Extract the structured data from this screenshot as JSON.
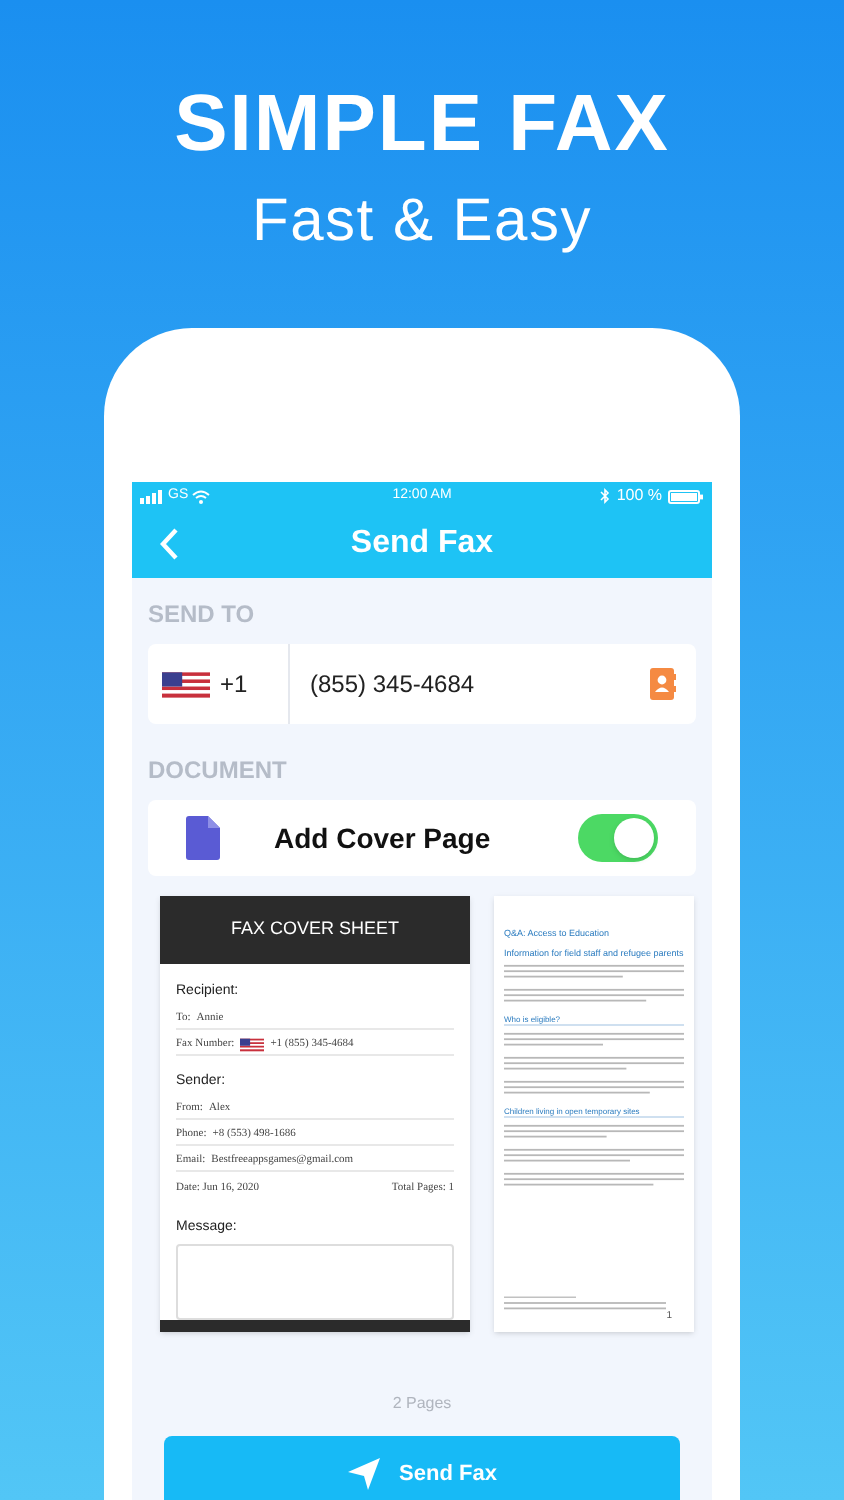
{
  "headline": {
    "title": "SIMPLE FAX",
    "subtitle": "Fast & Easy"
  },
  "status_bar": {
    "carrier": "GS",
    "time": "12:00 AM",
    "battery": "100 %"
  },
  "nav": {
    "title": "Send Fax"
  },
  "send_to": {
    "label": "SEND TO",
    "country_code": "+1",
    "number": "(855) 345-4684"
  },
  "document": {
    "label": "DOCUMENT",
    "cover_label": "Add Cover Page",
    "cover_on": true
  },
  "cover_sheet": {
    "title": "FAX COVER SHEET",
    "recipient_heading": "Recipient:",
    "recipient_rows": [
      {
        "kind": "text",
        "label": "To:",
        "value": "Annie"
      },
      {
        "kind": "flag",
        "label": "Fax Number:",
        "value": "+1 (855) 345-4684"
      }
    ],
    "sender_heading": "Sender:",
    "sender_rows": [
      {
        "label": "From:",
        "value": "Alex"
      },
      {
        "label": "Phone:",
        "value": "+8 (553) 498-1686"
      },
      {
        "label": "Email:",
        "value": "Bestfreeappsgames@gmail.com"
      }
    ],
    "date": "Date: Jun 16, 2020",
    "total_pages": "Total Pages: 1",
    "message_heading": "Message:"
  },
  "page_2": {
    "blocks": [
      {
        "kind": "title",
        "text": "Q&A: Access to Education"
      },
      {
        "kind": "title",
        "text": "Information for field staff and refugee parents"
      },
      {
        "kind": "paragraph"
      },
      {
        "kind": "paragraph"
      },
      {
        "kind": "heading",
        "text": "Who is eligible?"
      },
      {
        "kind": "paragraph"
      },
      {
        "kind": "paragraph"
      },
      {
        "kind": "paragraph"
      },
      {
        "kind": "heading",
        "text": "Children living in open temporary sites"
      },
      {
        "kind": "paragraph"
      },
      {
        "kind": "paragraph"
      },
      {
        "kind": "paragraph"
      }
    ],
    "page_number": "1"
  },
  "page_count": "2 Pages",
  "send_button": "Send Fax"
}
